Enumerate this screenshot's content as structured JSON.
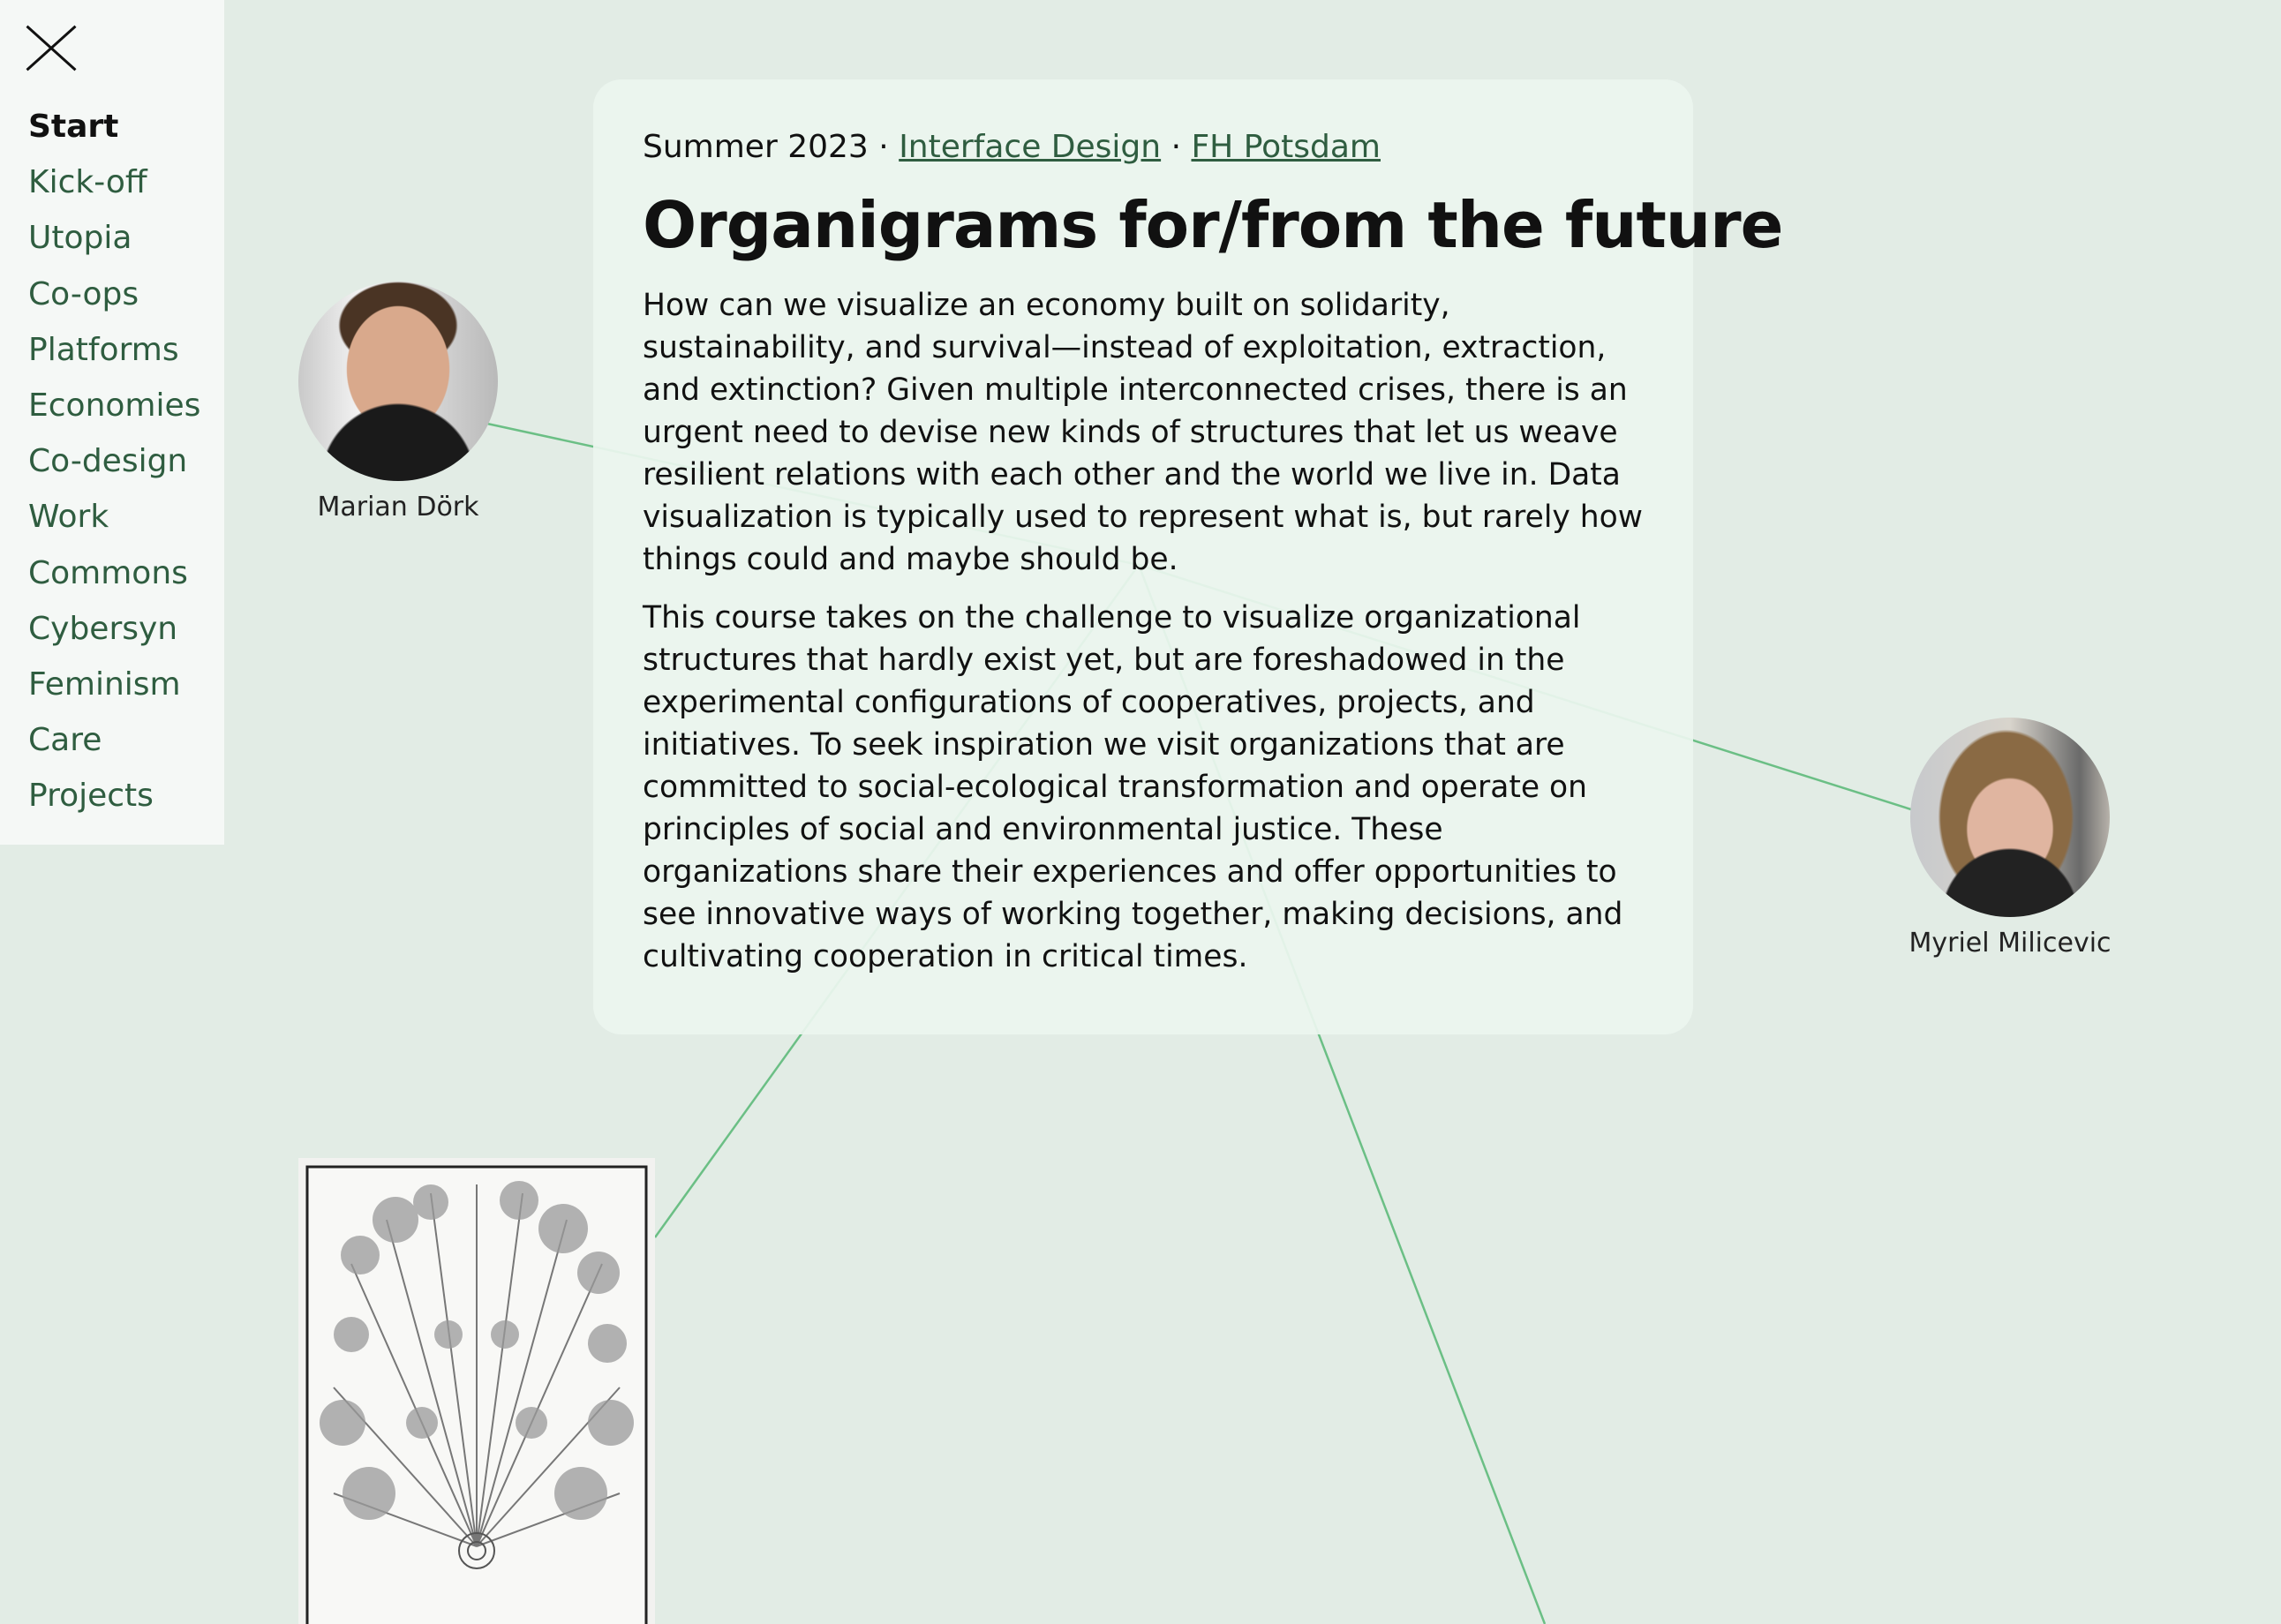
{
  "sidebar": {
    "close_icon": "close-icon",
    "items": [
      {
        "label": "Start",
        "active": true
      },
      {
        "label": "Kick-off"
      },
      {
        "label": "Utopia"
      },
      {
        "label": "Co-ops"
      },
      {
        "label": "Platforms"
      },
      {
        "label": "Economies"
      },
      {
        "label": "Co-design"
      },
      {
        "label": "Work"
      },
      {
        "label": "Commons"
      },
      {
        "label": "Cybersyn"
      },
      {
        "label": "Feminism"
      },
      {
        "label": "Care"
      },
      {
        "label": "Projects"
      }
    ]
  },
  "card": {
    "semester": "Summer 2023",
    "separator": "·",
    "link_design": "Interface Design",
    "link_school": "FH Potsdam",
    "title": "Organigrams for/from the future",
    "paragraphs": [
      "How can we visualize an economy built on solidarity, sustainability, and survival—instead of exploitation, extraction, and extinction? Given multiple interconnected crises, there is an urgent need to devise new kinds of structures that let us weave resilient relations with each other and the world we live in. Data visualization is typically used to represent what is, but rarely how things could and maybe should be.",
      "This course takes on the challenge to visualize organizational structures that hardly exist yet, but are foreshadowed in the experimental configurations of cooperatives, projects, and initiatives. To seek inspiration we visit organizations that are committed to social-ecological transformation and operate on principles of social and environmental justice. These organizations share their experiences and offer opportunities to see innovative ways of working together, making decisions, and cultivating cooperation in critical times."
    ]
  },
  "people": [
    {
      "name": "Marian Dörk"
    },
    {
      "name": "Myriel Milicevic"
    }
  ],
  "colors": {
    "background": "#e2ece5",
    "link": "#2f5d40",
    "edge": "#6bbf85",
    "card": "#ecf5ef"
  }
}
